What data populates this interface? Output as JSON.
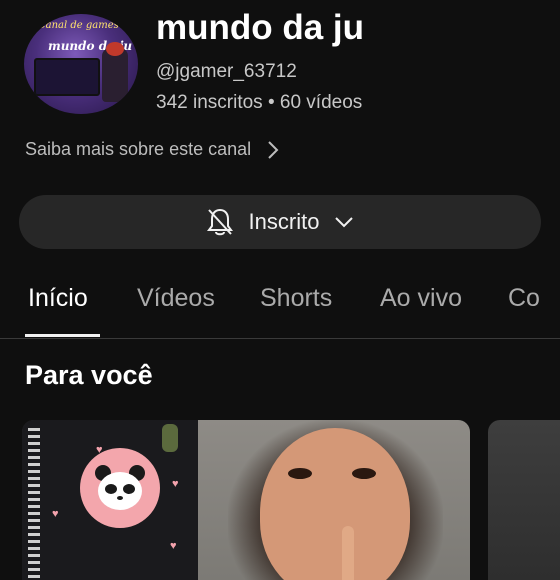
{
  "channel": {
    "avatar_text_top": "Canal de games",
    "avatar_text_name": "mundo da ju",
    "title": "mundo da ju",
    "handle": "@jgamer_63712",
    "subscribers": "342 inscritos",
    "separator": "•",
    "videos": "60 vídeos",
    "about_link": "Saiba mais sobre este canal"
  },
  "subscribe": {
    "label": "Inscrito",
    "bell_icon": "bell-off-icon",
    "dropdown_icon": "chevron-down-icon"
  },
  "tabs": [
    {
      "label": "Início",
      "active": true
    },
    {
      "label": "Vídeos"
    },
    {
      "label": "Shorts"
    },
    {
      "label": "Ao vivo"
    },
    {
      "label": "Co"
    }
  ],
  "section": {
    "title": "Para você"
  },
  "colors": {
    "background": "#0f0f0f",
    "button": "#272727",
    "text_primary": "#f1f1f1",
    "text_secondary": "#aaaaaa"
  }
}
